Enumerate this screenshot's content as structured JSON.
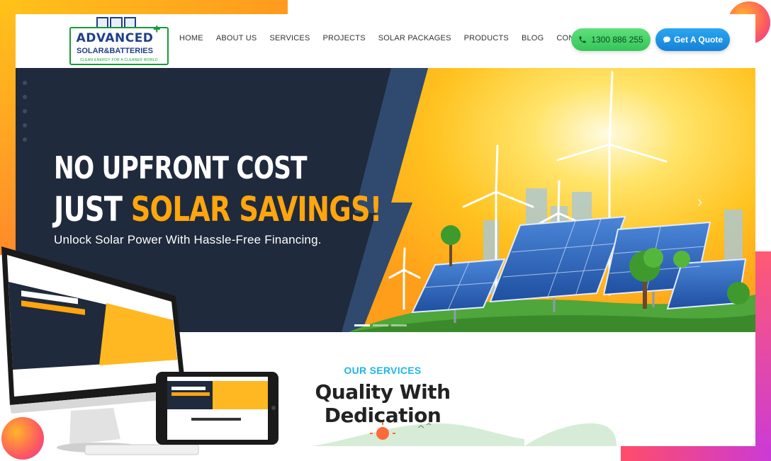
{
  "logo": {
    "line1": "ADVANCED",
    "line2": "SOLAR&BATTERIES",
    "tagline": "CLEAN ENERGY FOR A CLEANER WORLD"
  },
  "nav": {
    "items": [
      "HOME",
      "ABOUT US",
      "SERVICES",
      "PROJECTS",
      "SOLAR PACKAGES",
      "PRODUCTS",
      "BLOG",
      "CONTACT US"
    ]
  },
  "header": {
    "phone": "1300 886 255",
    "quote_label": "Get A Quote"
  },
  "hero": {
    "title_line1": "NO UPFRONT COST",
    "title_line2_a": "JUST ",
    "title_line2_b": "SOLAR SAVINGS!",
    "subtitle": "Unlock Solar Power With Hassle-Free Financing."
  },
  "services": {
    "label": "OUR SERVICES",
    "title": "Quality With Dedication"
  },
  "icons": {
    "phone": "phone-icon",
    "quote": "chat-bubble-icon",
    "next": "chevron-right-icon"
  },
  "colors": {
    "brand_blue": "#1f3f8a",
    "brand_green": "#1a9a3a",
    "hero_dark": "#1f2a3c",
    "highlight_orange": "#ffa50f",
    "accent_cyan": "#1fb6e8",
    "call_green": "#35c55a",
    "quote_blue": "#1681d6"
  }
}
